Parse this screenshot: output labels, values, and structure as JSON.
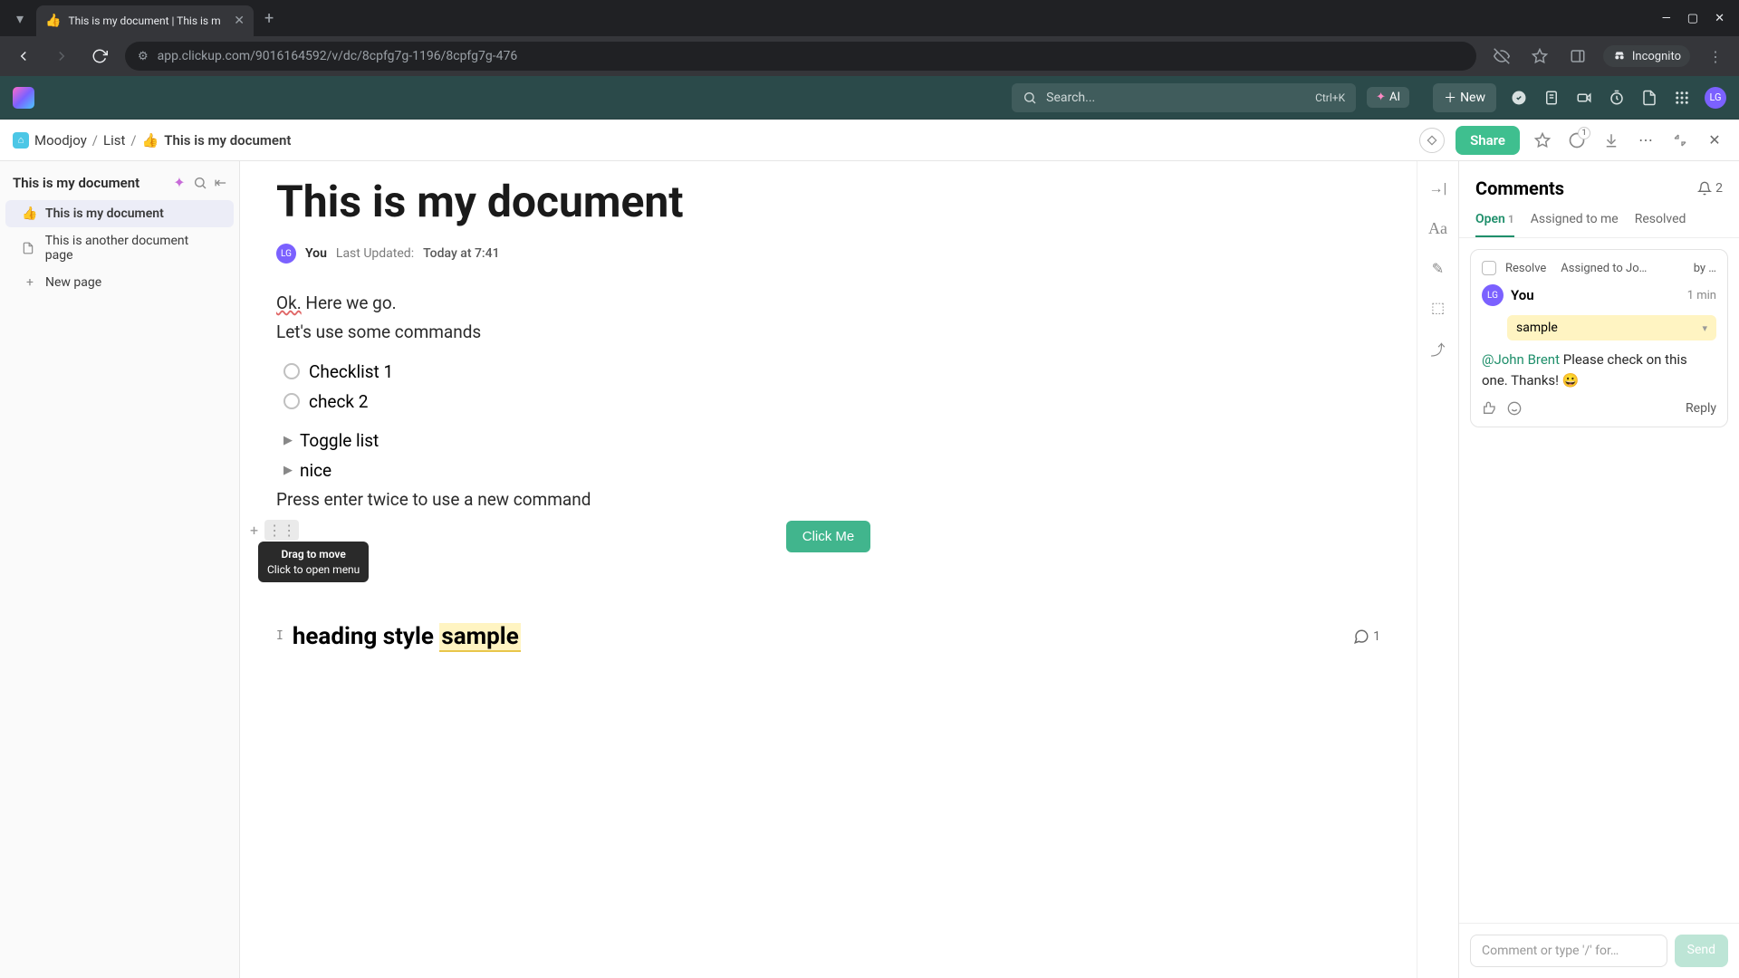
{
  "browser": {
    "tab_title": "This is my document | This is m",
    "tab_emoji": "👍",
    "url": "app.clickup.com/9016164592/v/dc/8cpfg7g-1196/8cpfg7g-476",
    "incognito": "Incognito"
  },
  "topbar": {
    "search_placeholder": "Search...",
    "search_kbd": "Ctrl+K",
    "ai_label": "AI",
    "new_label": "New",
    "avatar_initials": "LG"
  },
  "breadcrumb": {
    "workspace": "Moodjoy",
    "list": "List",
    "doc_emoji": "👍",
    "doc": "This is my document",
    "share": "Share",
    "timer_badge": "1"
  },
  "sidebar": {
    "title": "This is my document",
    "items": [
      {
        "emoji": "👍",
        "label": "This is my document",
        "active": true
      },
      {
        "icon": "doc",
        "label": "This is another document page",
        "active": false
      }
    ],
    "new_page": "New page"
  },
  "doc": {
    "title": "This is my document",
    "author_initials": "LG",
    "author": "You",
    "updated_label": "Last Updated:",
    "updated_time": "Today at 7:41",
    "line1a": "Ok.",
    "line1b": " Here we go.",
    "line2": "Let's use some commands",
    "checklist": [
      "Checklist 1",
      "check 2"
    ],
    "toggles": [
      "Toggle list",
      "nice"
    ],
    "line3": "Press enter twice to use a new command",
    "button": "Click Me",
    "tooltip_l1": "Drag to move",
    "tooltip_l2": "Click to open menu",
    "heading_prefix": "heading style ",
    "heading_highlight": "sample",
    "heading_comment_count": "1"
  },
  "comments": {
    "title": "Comments",
    "bell_count": "2",
    "tabs": {
      "open": "Open",
      "open_n": "1",
      "assigned": "Assigned to me",
      "resolved": "Resolved"
    },
    "card": {
      "resolve": "Resolve",
      "assigned_to": "Assigned to Jo…",
      "by": "by …",
      "author_initials": "LG",
      "author": "You",
      "time": "1 min",
      "quote": "sample",
      "mention": "@John Brent",
      "text": " Please check on this one. Thanks! 😀",
      "reply": "Reply"
    },
    "input_placeholder": "Comment or type '/' for…",
    "send": "Send"
  }
}
